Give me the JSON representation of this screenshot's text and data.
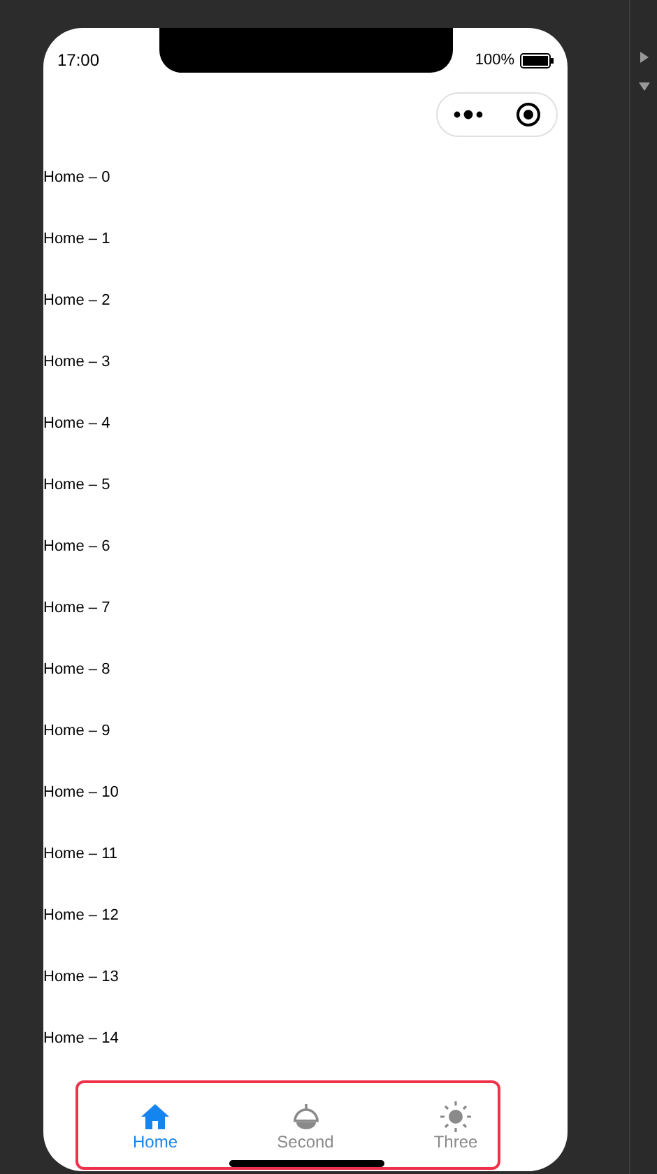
{
  "status_bar": {
    "time": "17:00",
    "battery": "100%"
  },
  "list": [
    "Home – 0",
    "Home – 1",
    "Home – 2",
    "Home – 3",
    "Home – 4",
    "Home – 5",
    "Home – 6",
    "Home – 7",
    "Home – 8",
    "Home – 9",
    "Home – 10",
    "Home – 11",
    "Home – 12",
    "Home – 13",
    "Home – 14"
  ],
  "tabs": [
    {
      "label": "Home",
      "kind": "home",
      "selected": true
    },
    {
      "label": "Second",
      "kind": "bell",
      "selected": false
    },
    {
      "label": "Three",
      "kind": "sun",
      "selected": false
    }
  ]
}
